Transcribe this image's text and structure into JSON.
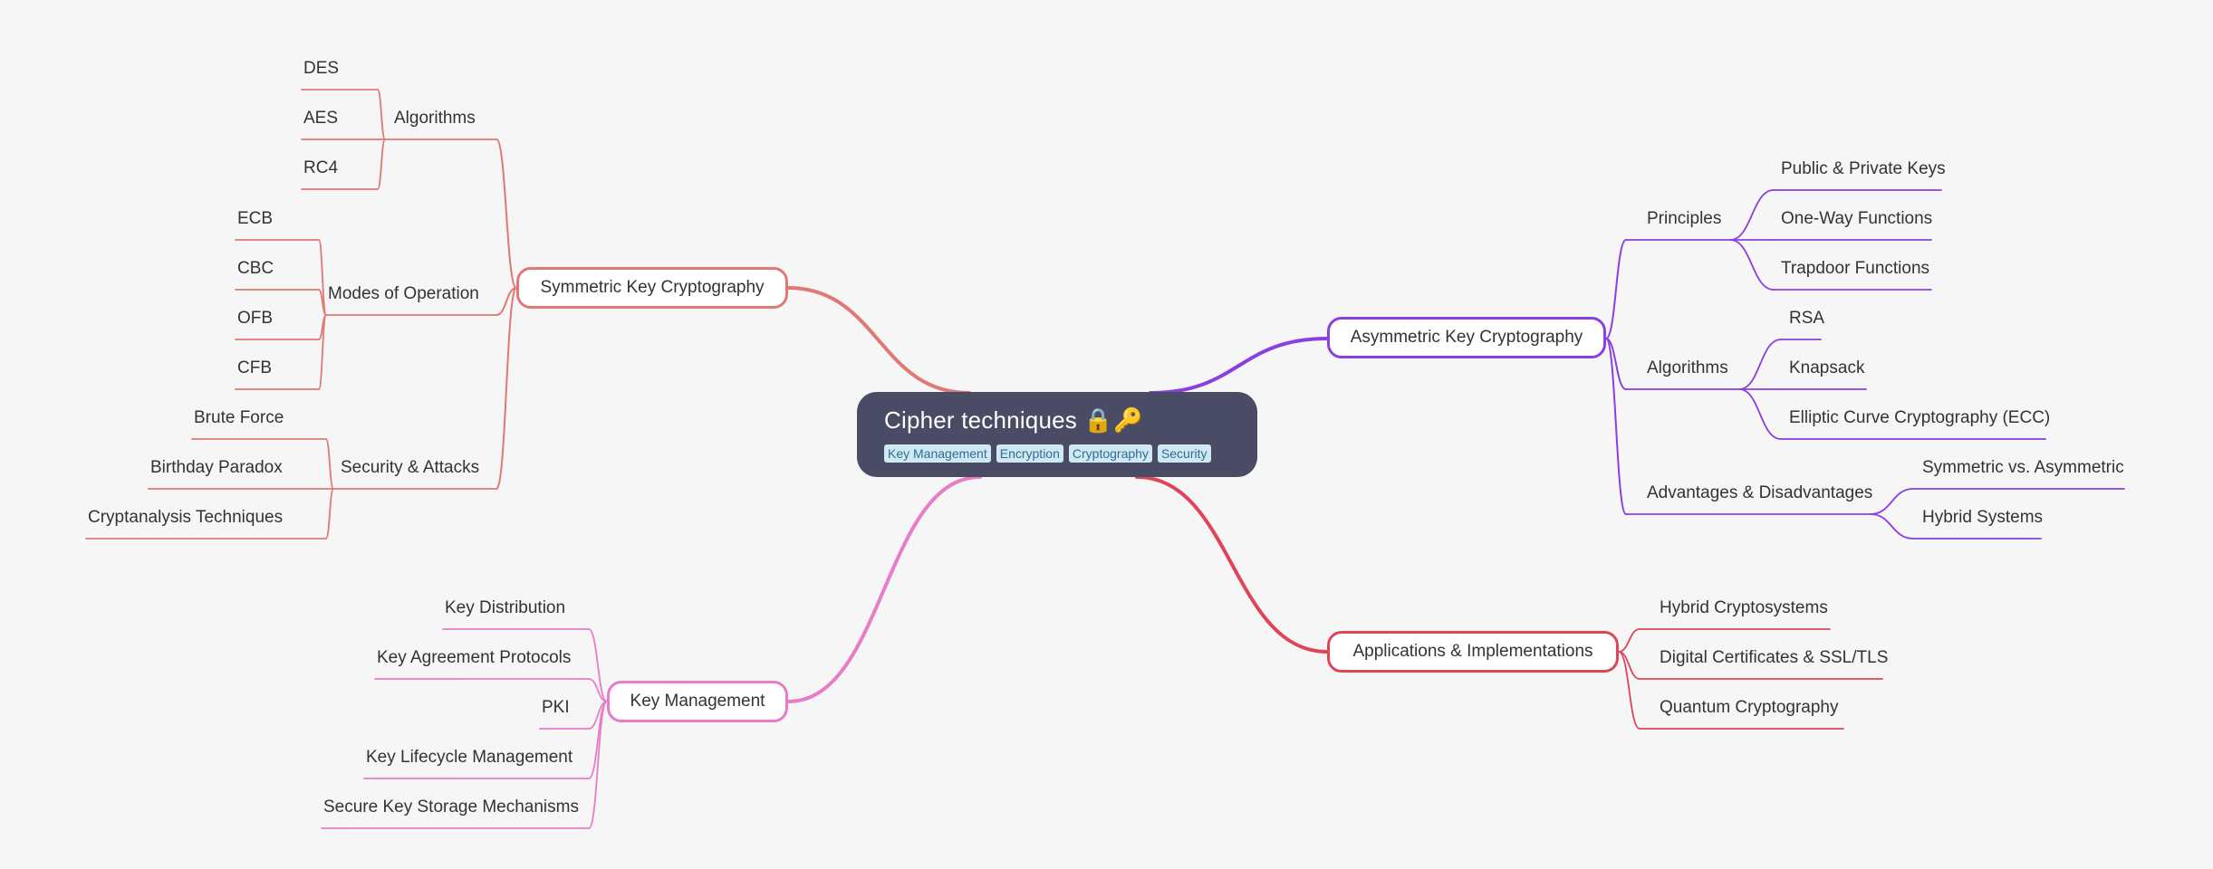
{
  "root": {
    "title": "Cipher techniques",
    "emoji": "🔒🔑",
    "tags": [
      "Key Management",
      "Encryption",
      "Cryptography",
      "Security"
    ]
  },
  "colors": {
    "background": "#f6f6f6",
    "root": "#4a4c66",
    "symmetric": "#e07873",
    "asymmetric": "#8a3fe0",
    "key_management": "#e87cc8",
    "applications": "#df4558",
    "tag_bg": "#cfe8f4",
    "tag_text": "#2f6f8e"
  },
  "branches": {
    "symmetric": {
      "label": "Symmetric Key Cryptography",
      "groups": [
        {
          "label": "Algorithms",
          "items": [
            "DES",
            "AES",
            "RC4"
          ]
        },
        {
          "label": "Modes of Operation",
          "items": [
            "ECB",
            "CBC",
            "OFB",
            "CFB"
          ]
        },
        {
          "label": "Security & Attacks",
          "items": [
            "Brute Force",
            "Birthday Paradox",
            "Cryptanalysis Techniques"
          ]
        }
      ]
    },
    "asymmetric": {
      "label": "Asymmetric Key Cryptography",
      "groups": [
        {
          "label": "Principles",
          "items": [
            "Public & Private Keys",
            "One-Way Functions",
            "Trapdoor Functions"
          ]
        },
        {
          "label": "Algorithms",
          "items": [
            "RSA",
            "Knapsack",
            "Elliptic Curve Cryptography (ECC)"
          ]
        },
        {
          "label": "Advantages & Disadvantages",
          "items": [
            "Symmetric vs. Asymmetric",
            "Hybrid Systems"
          ]
        }
      ]
    },
    "key_management": {
      "label": "Key Management",
      "items": [
        "Key Distribution",
        "Key Agreement Protocols",
        "PKI",
        "Key Lifecycle Management",
        "Secure Key Storage Mechanisms"
      ]
    },
    "applications": {
      "label": "Applications & Implementations",
      "items": [
        "Hybrid Cryptosystems",
        "Digital Certificates & SSL/TLS",
        "Quantum Cryptography"
      ]
    }
  }
}
